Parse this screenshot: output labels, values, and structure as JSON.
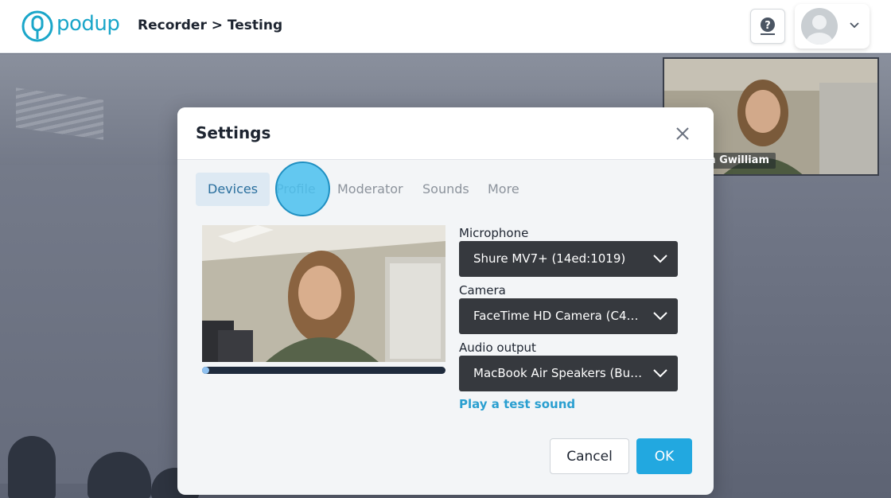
{
  "header": {
    "brand": "podup",
    "breadcrumb": "Recorder > Testing"
  },
  "participant": {
    "name_tag": "an Gwilliam"
  },
  "settings": {
    "title": "Settings",
    "tabs": [
      {
        "label": "Devices",
        "active": true
      },
      {
        "label": "Profile",
        "active": false
      },
      {
        "label": "Moderator",
        "active": false
      },
      {
        "label": "Sounds",
        "active": false
      },
      {
        "label": "More",
        "active": false
      }
    ],
    "mic_level": 0.02,
    "microphone": {
      "label": "Microphone",
      "value": "Shure MV7+ (14ed:1019)"
    },
    "camera": {
      "label": "Camera",
      "value": "FaceTime HD Camera (C4E1..."
    },
    "audio_output": {
      "label": "Audio output",
      "value": "MacBook Air Speakers (Built..."
    },
    "test_sound_link": "Play a test sound",
    "cancel_label": "Cancel",
    "ok_label": "OK"
  },
  "colors": {
    "brand": "#1aa6c9",
    "primary_button": "#22a8e0",
    "active_tab_bg": "#dde9f3",
    "select_bg": "#36393e"
  },
  "icons": [
    "help-icon",
    "avatar-icon",
    "chevron-down-icon",
    "close-icon"
  ]
}
